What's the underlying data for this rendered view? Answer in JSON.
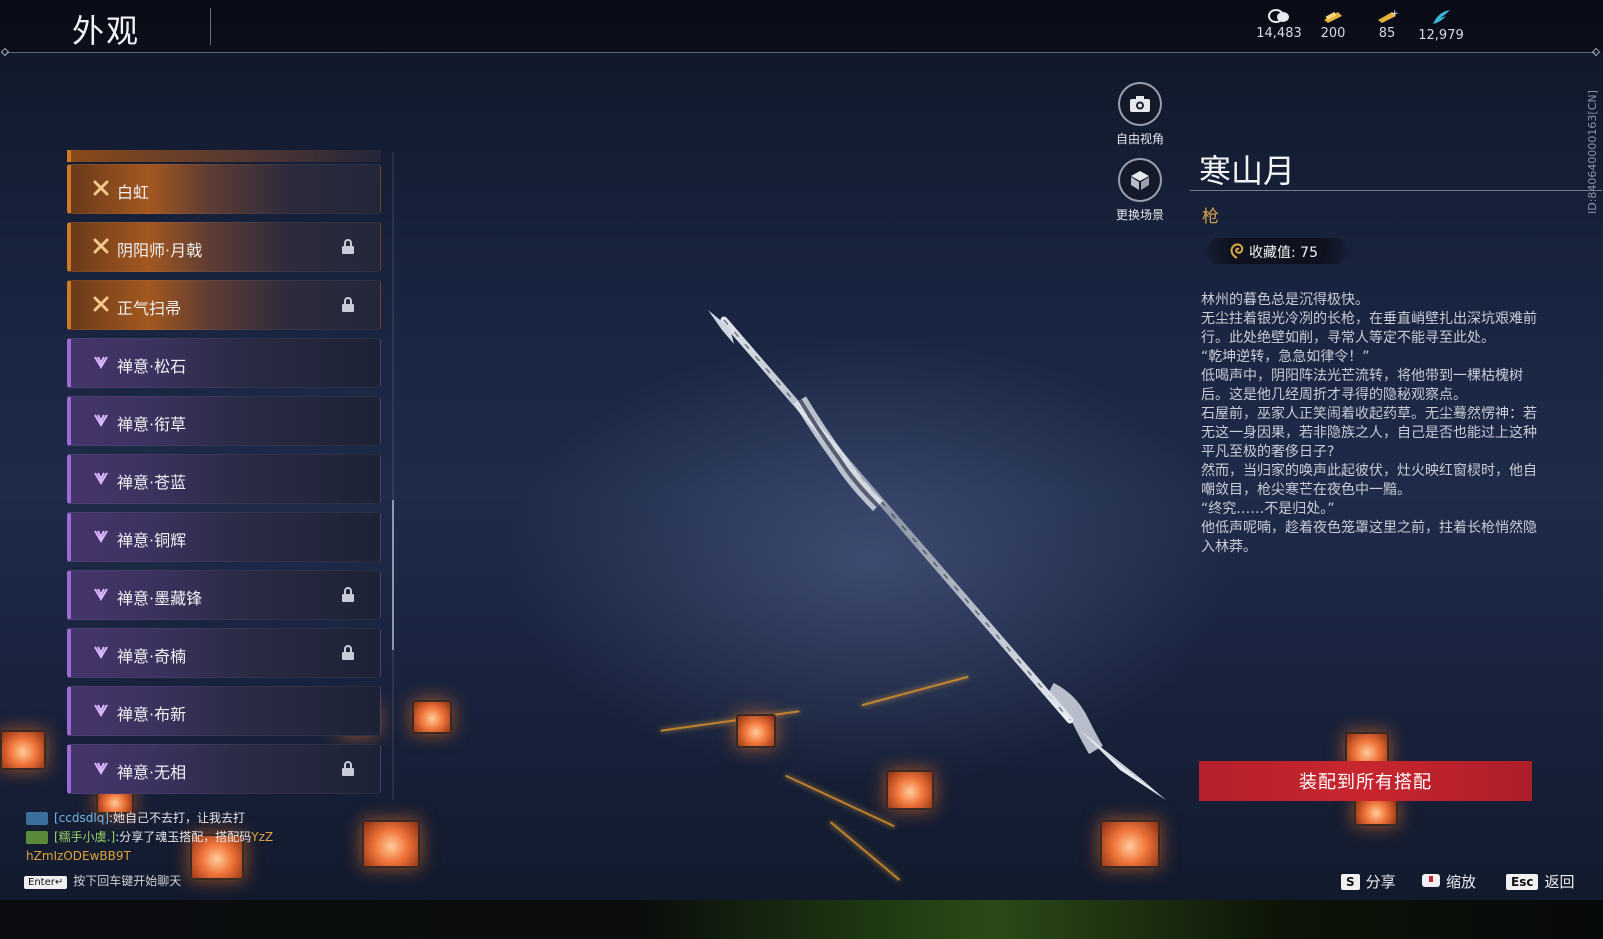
{
  "header": {
    "title": "外观",
    "currencies": [
      {
        "icon": "coin-stack-icon",
        "value": "14,483"
      },
      {
        "icon": "gold-ticket-icon",
        "value": "200"
      },
      {
        "icon": "gold-ticket-plus-icon",
        "value": "85"
      },
      {
        "icon": "feather-icon",
        "value": "12,979"
      }
    ]
  },
  "list": {
    "items": [
      {
        "label": "白虹",
        "rarity": "gold",
        "locked": false
      },
      {
        "label": "阴阳师·月戟",
        "rarity": "gold",
        "locked": true
      },
      {
        "label": "正气扫帚",
        "rarity": "gold",
        "locked": true
      },
      {
        "label": "禅意·松石",
        "rarity": "purple",
        "locked": false
      },
      {
        "label": "禅意·衔草",
        "rarity": "purple",
        "locked": false
      },
      {
        "label": "禅意·苍蓝",
        "rarity": "purple",
        "locked": false
      },
      {
        "label": "禅意·铜辉",
        "rarity": "purple",
        "locked": false
      },
      {
        "label": "禅意·墨藏锋",
        "rarity": "purple",
        "locked": true
      },
      {
        "label": "禅意·奇楠",
        "rarity": "purple",
        "locked": true
      },
      {
        "label": "禅意·布新",
        "rarity": "purple",
        "locked": false
      },
      {
        "label": "禅意·无相",
        "rarity": "purple",
        "locked": true
      }
    ]
  },
  "view_controls": {
    "free_view": "自由视角",
    "change_scene": "更换场景"
  },
  "detail": {
    "name": "寒山月",
    "type": "枪",
    "collection": "收藏值: 75",
    "description": [
      "林州的暮色总是沉得极快。",
      "无尘拄着银光冷冽的长枪，在垂直峭壁扎出深坑艰难前行。此处绝壁如削，寻常人等定不能寻至此处。",
      "“乾坤逆转，急急如律令！”",
      "低喝声中，阴阳阵法光芒流转，将他带到一棵枯槐树后。这是他几经周折才寻得的隐秘观察点。",
      "石屋前，巫家人正笑闹着收起药草。无尘蓦然愣神：若无这一身因果，若非隐族之人，自己是否也能过上这种平凡至极的奢侈日子?",
      "然而，当归家的唤声此起彼伏，灶火映红窗棂时，他自嘲敛目，枪尖寒芒在夜色中一黯。",
      "“终究……不是归处。”",
      "他低声呢喃，趁着夜色笼罩这里之前，拄着长枪悄然隐入林莽。"
    ],
    "id_text": "ID:840640000163[CN]"
  },
  "equip_button": "装配到所有搭配",
  "chat": {
    "messages": [
      {
        "user": "[ccdsdlq]",
        "text": ":她自己不去打，让我去打",
        "code": ""
      },
      {
        "user": "[糯手小虞.]",
        "text": ":分享了魂玉搭配，搭配码",
        "code": "YzZ"
      }
    ],
    "code_continued": "hZmIzODEwBB9T",
    "enter_key": "Enter↵",
    "enter_hint": "按下回车键开始聊天"
  },
  "hints": {
    "share_key": "S",
    "share": "分享",
    "zoom": "缩放",
    "back_key": "Esc",
    "back": "返回"
  },
  "colors": {
    "gold_rarity": "#d07a25",
    "purple_rarity": "#9b6ad6",
    "equip_red": "#c8262f",
    "type_gold": "#d6a24a"
  }
}
